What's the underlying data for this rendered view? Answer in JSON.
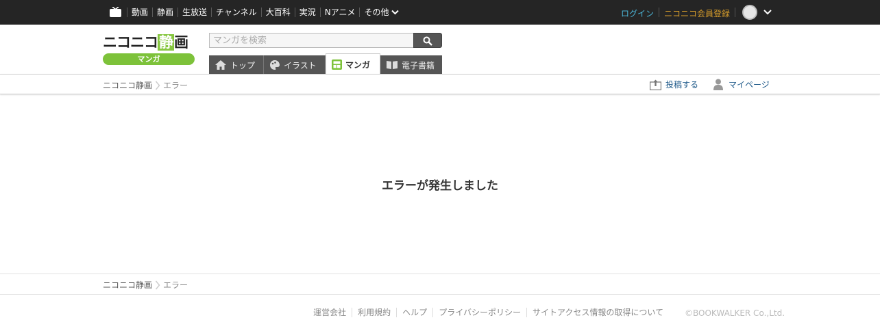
{
  "topbar": {
    "nav": [
      "動画",
      "静画",
      "生放送",
      "チャンネル",
      "大百科",
      "実況",
      "Nアニメ"
    ],
    "more": "その他",
    "login": "ログイン",
    "register": "ニコニコ会員登録"
  },
  "logo": {
    "brand_a": "ニコニコ",
    "brand_b": "静",
    "brand_c": "画",
    "sub": "マンガ"
  },
  "search": {
    "placeholder": "マンガを検索"
  },
  "tabs": [
    {
      "label": "トップ",
      "icon": "home-icon"
    },
    {
      "label": "イラスト",
      "icon": "illust-icon"
    },
    {
      "label": "マンガ",
      "icon": "manga-icon",
      "active": true
    },
    {
      "label": "電子書籍",
      "icon": "book-icon"
    }
  ],
  "breadcrumb": {
    "home": "ニコニコ静画",
    "current": "エラー"
  },
  "actions": {
    "post": "投稿する",
    "mypage": "マイページ"
  },
  "main": {
    "error_message": "エラーが発生しました"
  },
  "footer": {
    "links": [
      "運営会社",
      "利用規約",
      "ヘルプ",
      "プライバシーポリシー",
      "サイトアクセス情報の取得について"
    ],
    "copyright": "©BOOKWALKER Co.,Ltd."
  },
  "colors": {
    "topbar_bg": "#252525",
    "login": "#4cb6d8",
    "register": "#d59c2b",
    "brand_green": "#7dc23a",
    "link_blue": "#1f5a8a"
  }
}
